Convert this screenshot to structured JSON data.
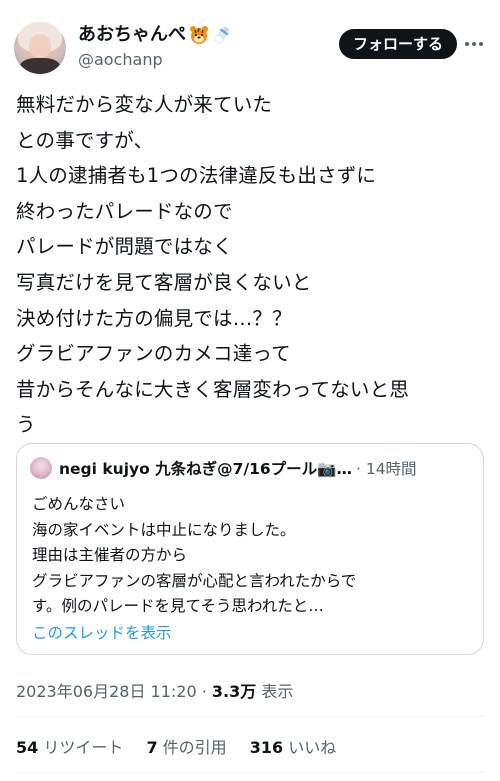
{
  "author": {
    "display_name": "あおちゃんぺ",
    "handle": "@aochanp",
    "follow_label": "フォローする",
    "emoji_icons": [
      "tiger-face-icon",
      "baby-bottle-icon"
    ]
  },
  "tweet": {
    "lines": [
      "無料だから変な人が来ていた",
      "との事ですが、",
      "1人の逮捕者も1つの法律違反も出さずに",
      "終わったパレードなので",
      "パレードが問題ではなく",
      "写真だけを見て客層が良くないと",
      "決め付けた方の偏見では…？？",
      "グラビアファンのカメコ達って",
      "昔からそんなに大きく客層変わってないと思",
      "う"
    ]
  },
  "quote": {
    "author_name": "negi kujyo 九条ねぎ@7/16プール📷…",
    "time": "· 14時間",
    "lines": [
      "ごめんなさい",
      "海の家イベントは中止になりました。",
      "理由は主催者の方から",
      "グラビアファンの客層が心配と言われたからで",
      "す。例のパレードを見てそう思われたと…"
    ],
    "thread_link": "このスレッドを表示"
  },
  "meta": {
    "date": "2023年06月28日 11:20",
    "sep": " · ",
    "views_count": "3.3万",
    "views_label": " 表示"
  },
  "stats": {
    "retweets_count": "54",
    "retweets_label": " リツイート",
    "quotes_count": "7",
    "quotes_label": " 件の引用",
    "likes_count": "316",
    "likes_label": " いいね"
  }
}
